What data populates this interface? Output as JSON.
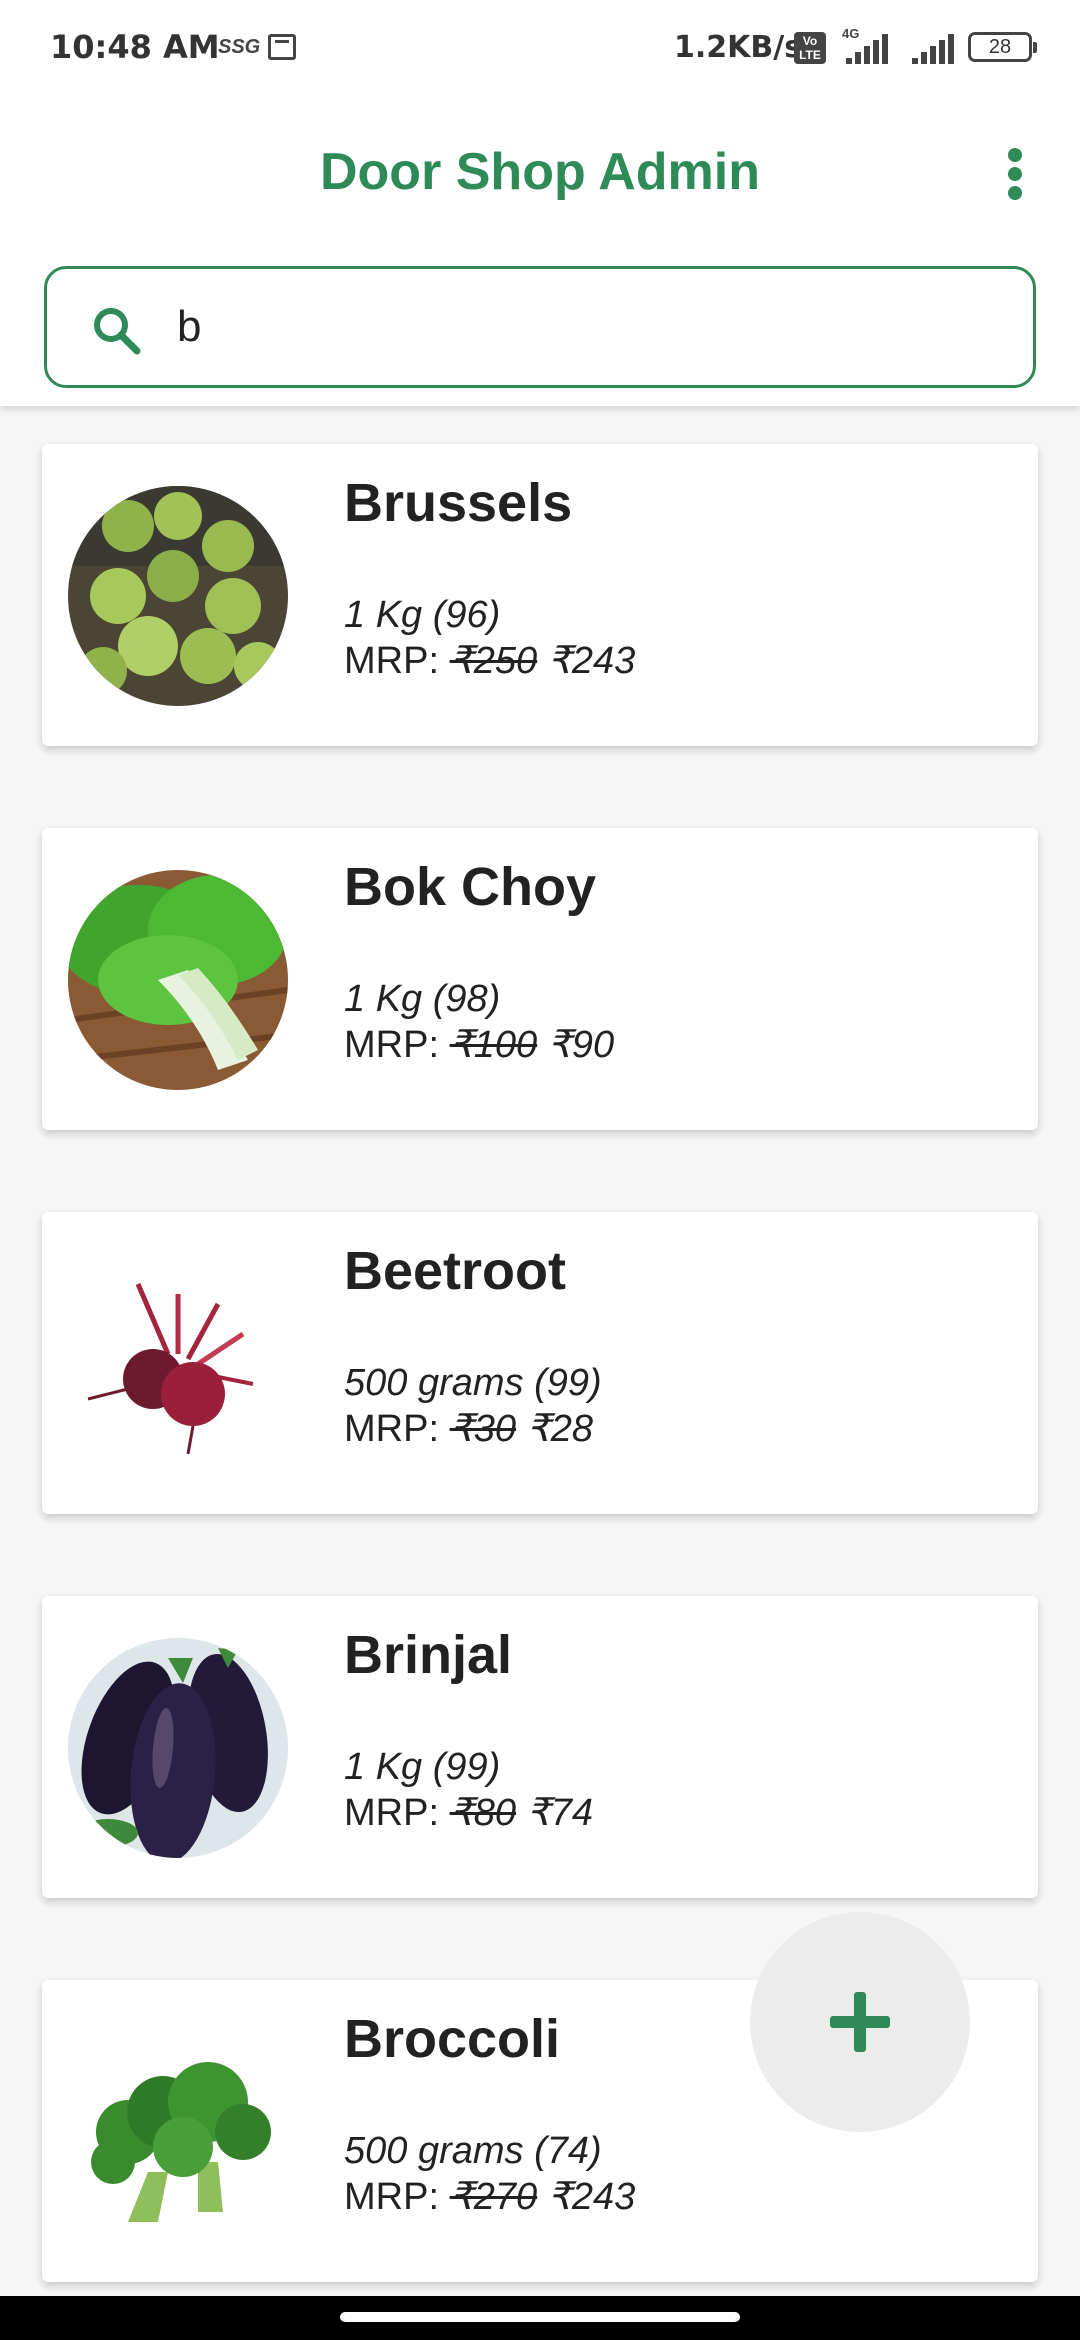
{
  "status_bar": {
    "time": "10:48 AM",
    "carrier_tag": "SSG",
    "speed": "1.2KB/s",
    "volte": "Vo LTE",
    "network_type": "4G",
    "battery": "28"
  },
  "app_bar": {
    "title": "Door Shop Admin",
    "menu_icon": "more-vert-icon"
  },
  "search": {
    "value": "b",
    "icon": "search-icon"
  },
  "colors": {
    "accent": "#2e8b57",
    "fab_background": "#ececec"
  },
  "products": [
    {
      "name": "Brussels",
      "quantity": "1 Kg (96)",
      "mrp_label": "MRP:",
      "old_price": "₹250",
      "new_price": "₹243",
      "image": "brussels-sprouts-image"
    },
    {
      "name": "Bok Choy",
      "quantity": "1 Kg (98)",
      "mrp_label": "MRP:",
      "old_price": "₹100",
      "new_price": "₹90",
      "image": "bok-choy-image"
    },
    {
      "name": "Beetroot",
      "quantity": "500 grams (99)",
      "mrp_label": "MRP:",
      "old_price": "₹30",
      "new_price": "₹28",
      "image": "beetroot-image"
    },
    {
      "name": "Brinjal",
      "quantity": "1 Kg (99)",
      "mrp_label": "MRP:",
      "old_price": "₹80",
      "new_price": "₹74",
      "image": "brinjal-image"
    },
    {
      "name": "Broccoli",
      "quantity": "500 grams (74)",
      "mrp_label": "MRP:",
      "old_price": "₹270",
      "new_price": "₹243",
      "image": "broccoli-image"
    }
  ],
  "fab": {
    "icon": "plus-icon"
  }
}
